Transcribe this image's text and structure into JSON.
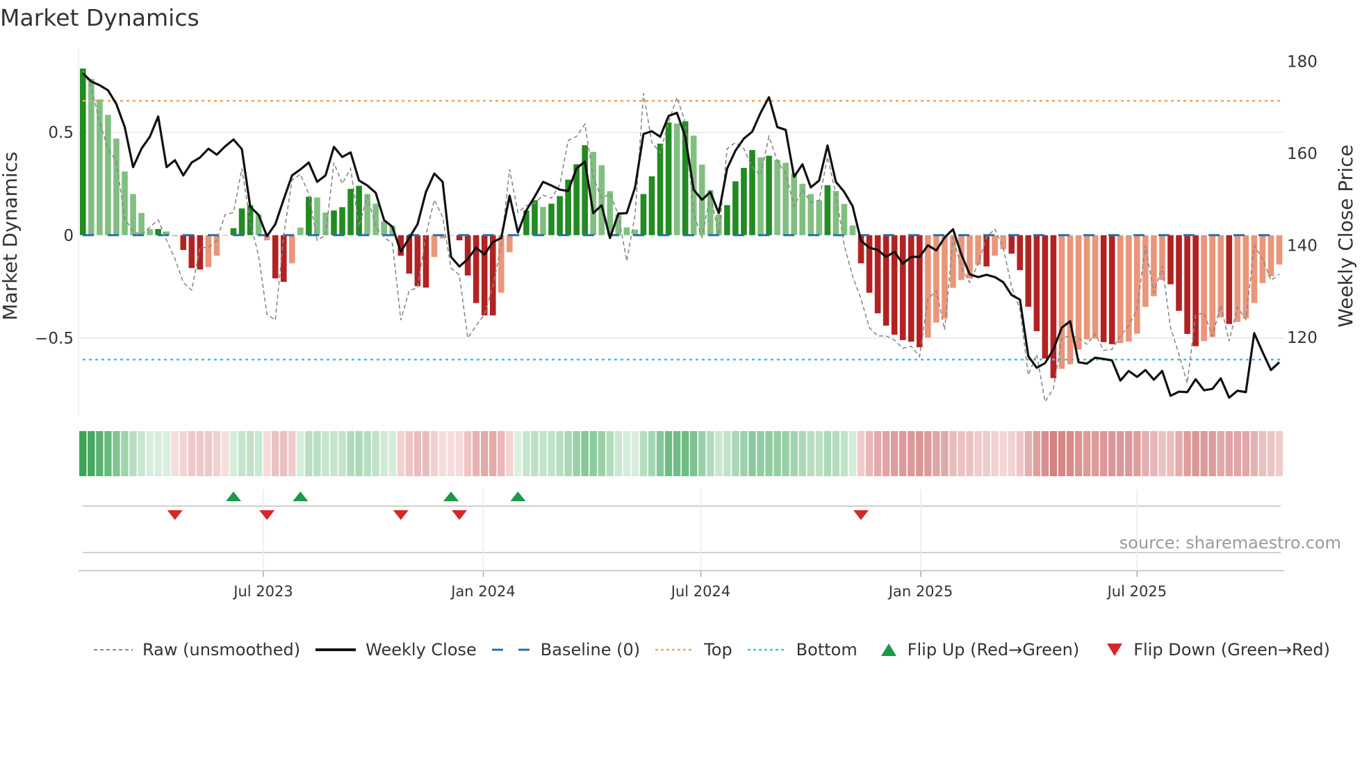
{
  "title": "Market Dynamics",
  "source": "source: sharemaestro.com",
  "legend": {
    "raw": "Raw (unsmoothed)",
    "close": "Weekly Close",
    "baseline": "Baseline (0)",
    "top": "Top",
    "bottom": "Bottom",
    "flip_up": "Flip Up (Red→Green)",
    "flip_down": "Flip Down (Green→Red)"
  },
  "colors": {
    "up_strong": "#228b22",
    "up_weak": "#80bf80",
    "down_strong": "#b22222",
    "down_weak": "#e9967a",
    "raw": "#888888",
    "close": "#111111",
    "baseline": "#2a6fa8",
    "top": "#f0a35e",
    "bottom": "#3bc3e0",
    "flip_up": "#1a9a48",
    "flip_down": "#d62728"
  },
  "chart_data": {
    "type": "bar",
    "title": "Market Dynamics",
    "ylabel": "Market Dynamics",
    "y2label": "Weekly Close Price",
    "x_start": "2023-01-31",
    "x_step_days": 7,
    "ylim": [
      -0.875,
      0.87
    ],
    "y2lim": [
      103.1,
      181.1
    ],
    "y_ticks": [
      {
        "v": 0.5,
        "label": "0.5"
      },
      {
        "v": 0,
        "label": "0"
      },
      {
        "v": -0.5,
        "label": "−0.5"
      }
    ],
    "y2_ticks": [
      {
        "v": 180,
        "label": "180"
      },
      {
        "v": 160,
        "label": "160"
      },
      {
        "v": 140,
        "label": "140"
      },
      {
        "v": 120,
        "label": "120"
      }
    ],
    "x_ticks": [
      {
        "date": "2023-07-01",
        "label": "Jul 2023"
      },
      {
        "date": "2024-01-01",
        "label": "Jan 2024"
      },
      {
        "date": "2024-07-01",
        "label": "Jul 2024"
      },
      {
        "date": "2025-01-01",
        "label": "Jan 2025"
      },
      {
        "date": "2025-07-01",
        "label": "Jul 2025"
      }
    ],
    "baseline": 0,
    "top": 0.653,
    "bottom": -0.605,
    "momentum": [
      0.81,
      0.76,
      0.66,
      0.585,
      0.47,
      0.31,
      0.2,
      0.108,
      0.03,
      0.03,
      0.018,
      -0.005,
      -0.072,
      -0.16,
      -0.167,
      -0.155,
      -0.1,
      -0.003,
      0.034,
      0.13,
      0.146,
      0.1,
      -0.025,
      -0.21,
      -0.227,
      -0.137,
      0.037,
      0.187,
      0.183,
      0.11,
      0.12,
      0.136,
      0.225,
      0.24,
      0.2,
      0.153,
      0.068,
      0.045,
      -0.1,
      -0.187,
      -0.248,
      -0.255,
      -0.106,
      -0.016,
      -0.002,
      -0.025,
      -0.196,
      -0.33,
      -0.39,
      -0.39,
      -0.28,
      -0.083,
      0.003,
      0.12,
      0.17,
      0.137,
      0.153,
      0.19,
      0.27,
      0.345,
      0.437,
      0.405,
      0.34,
      0.214,
      0.1,
      0.038,
      0.027,
      0.2,
      0.286,
      0.445,
      0.548,
      0.543,
      0.554,
      0.484,
      0.343,
      0.22,
      0.1,
      0.146,
      0.262,
      0.327,
      0.414,
      0.378,
      0.386,
      0.366,
      0.352,
      0.3,
      0.25,
      0.2,
      0.17,
      0.243,
      0.215,
      0.152,
      0.047,
      -0.137,
      -0.28,
      -0.38,
      -0.44,
      -0.484,
      -0.51,
      -0.518,
      -0.545,
      -0.498,
      -0.425,
      -0.405,
      -0.256,
      -0.218,
      -0.21,
      -0.144,
      -0.152,
      -0.1,
      -0.068,
      -0.09,
      -0.17,
      -0.348,
      -0.467,
      -0.6,
      -0.695,
      -0.65,
      -0.628,
      -0.556,
      -0.507,
      -0.503,
      -0.52,
      -0.53,
      -0.525,
      -0.517,
      -0.479,
      -0.349,
      -0.297,
      -0.218,
      -0.239,
      -0.368,
      -0.48,
      -0.54,
      -0.515,
      -0.495,
      -0.4,
      -0.432,
      -0.422,
      -0.405,
      -0.33,
      -0.233,
      -0.2,
      -0.143
    ],
    "raw": [
      0.8,
      0.72,
      0.55,
      0.42,
      0.36,
      0.08,
      0.02,
      0,
      0.04,
      0.074,
      -0.025,
      -0.115,
      -0.23,
      -0.267,
      -0.06,
      -0.06,
      -0.025,
      0.1,
      0.11,
      0.324,
      0.065,
      -0.1,
      -0.385,
      -0.413,
      0,
      0.268,
      0.296,
      0.2,
      -0.025,
      0,
      0.352,
      0.25,
      0.324,
      0.043,
      0.19,
      0.043,
      -0.01,
      -0.04,
      -0.413,
      -0.27,
      -0.255,
      0,
      0.172,
      0.088,
      -0.16,
      -0.194,
      -0.5,
      -0.44,
      -0.385,
      -0.25,
      -0.047,
      0.32,
      0.11,
      0.144,
      0.155,
      0.195,
      0.18,
      0.245,
      0.46,
      0.48,
      0.54,
      0.28,
      0.18,
      0.2,
      0.1,
      -0.126,
      0.1,
      0.69,
      0.45,
      0.4,
      0.55,
      0.67,
      0.55,
      0.1,
      -0.01,
      0.2,
      0.0,
      0.42,
      0.45,
      0.42,
      0.33,
      0.29,
      0.48,
      0.36,
      0.3,
      0.14,
      0.22,
      0.16,
      0.17,
      0.38,
      0.2,
      -0.05,
      -0.2,
      -0.31,
      -0.45,
      -0.49,
      -0.49,
      -0.51,
      -0.55,
      -0.54,
      -0.59,
      -0.31,
      -0.27,
      -0.46,
      -0.01,
      -0.16,
      -0.23,
      -0.14,
      -0.01,
      0.03,
      -0.06,
      -0.25,
      -0.36,
      -0.68,
      -0.58,
      -0.81,
      -0.745,
      -0.5,
      -0.49,
      -0.5,
      -0.53,
      -0.48,
      -0.56,
      -0.555,
      -0.49,
      -0.44,
      -0.36,
      -0.05,
      -0.28,
      -0.15,
      -0.45,
      -0.58,
      -0.72,
      -0.385,
      -0.38,
      -0.49,
      -0.34,
      -0.515,
      -0.35,
      -0.41,
      -0.05,
      -0.115,
      -0.22,
      -0.19
    ],
    "close": [
      177.4,
      175.6,
      174.8,
      173.7,
      170.7,
      165.7,
      157,
      161,
      163.6,
      168,
      157,
      158.5,
      155.2,
      158,
      159.1,
      161,
      159.7,
      161.5,
      163,
      160.9,
      148.4,
      146.6,
      142,
      144.6,
      150,
      155.2,
      156.5,
      158,
      153.8,
      155.2,
      161.4,
      159.2,
      160.2,
      154.1,
      153,
      151.4,
      145.5,
      144,
      138.6,
      141.6,
      144.6,
      151.6,
      155.6,
      153.8,
      137.5,
      135.4,
      137,
      139.5,
      138,
      140.7,
      141.6,
      150.8,
      142.8,
      147.6,
      150.6,
      153.8,
      153,
      152.1,
      151.8,
      156.7,
      158.2,
      147,
      148.7,
      141.6,
      146.9,
      147,
      152.6,
      164.2,
      164.8,
      163.6,
      168.1,
      168.8,
      163.6,
      152.1,
      149.9,
      151.6,
      147,
      156.7,
      160.6,
      163.2,
      164.7,
      168.8,
      172.2,
      165.7,
      165.1,
      154.9,
      157.6,
      152.6,
      154.1,
      161.7,
      153.8,
      151.6,
      148.5,
      141,
      139.5,
      139,
      137.5,
      138.6,
      136,
      137.5,
      137.5,
      140,
      138.9,
      141.7,
      143.5,
      138,
      133.7,
      133.1,
      133.6,
      133.1,
      132,
      129.2,
      128.2,
      115.9,
      113.4,
      114.4,
      117.4,
      122.1,
      123.5,
      114.6,
      114.3,
      115.6,
      115.3,
      115,
      110.6,
      112.7,
      111.4,
      112.9,
      110.8,
      112.7,
      107.3,
      108.2,
      108.1,
      110.9,
      108.5,
      108.8,
      111.1,
      106.9,
      108.4,
      108.1,
      120.9,
      116.8,
      112.9,
      114.6
    ],
    "flip_up_week": [
      19,
      27,
      45,
      53
    ],
    "flip_down_week": [
      12,
      23,
      39,
      46,
      94
    ],
    "grid": true,
    "legend_position": "bottom"
  }
}
